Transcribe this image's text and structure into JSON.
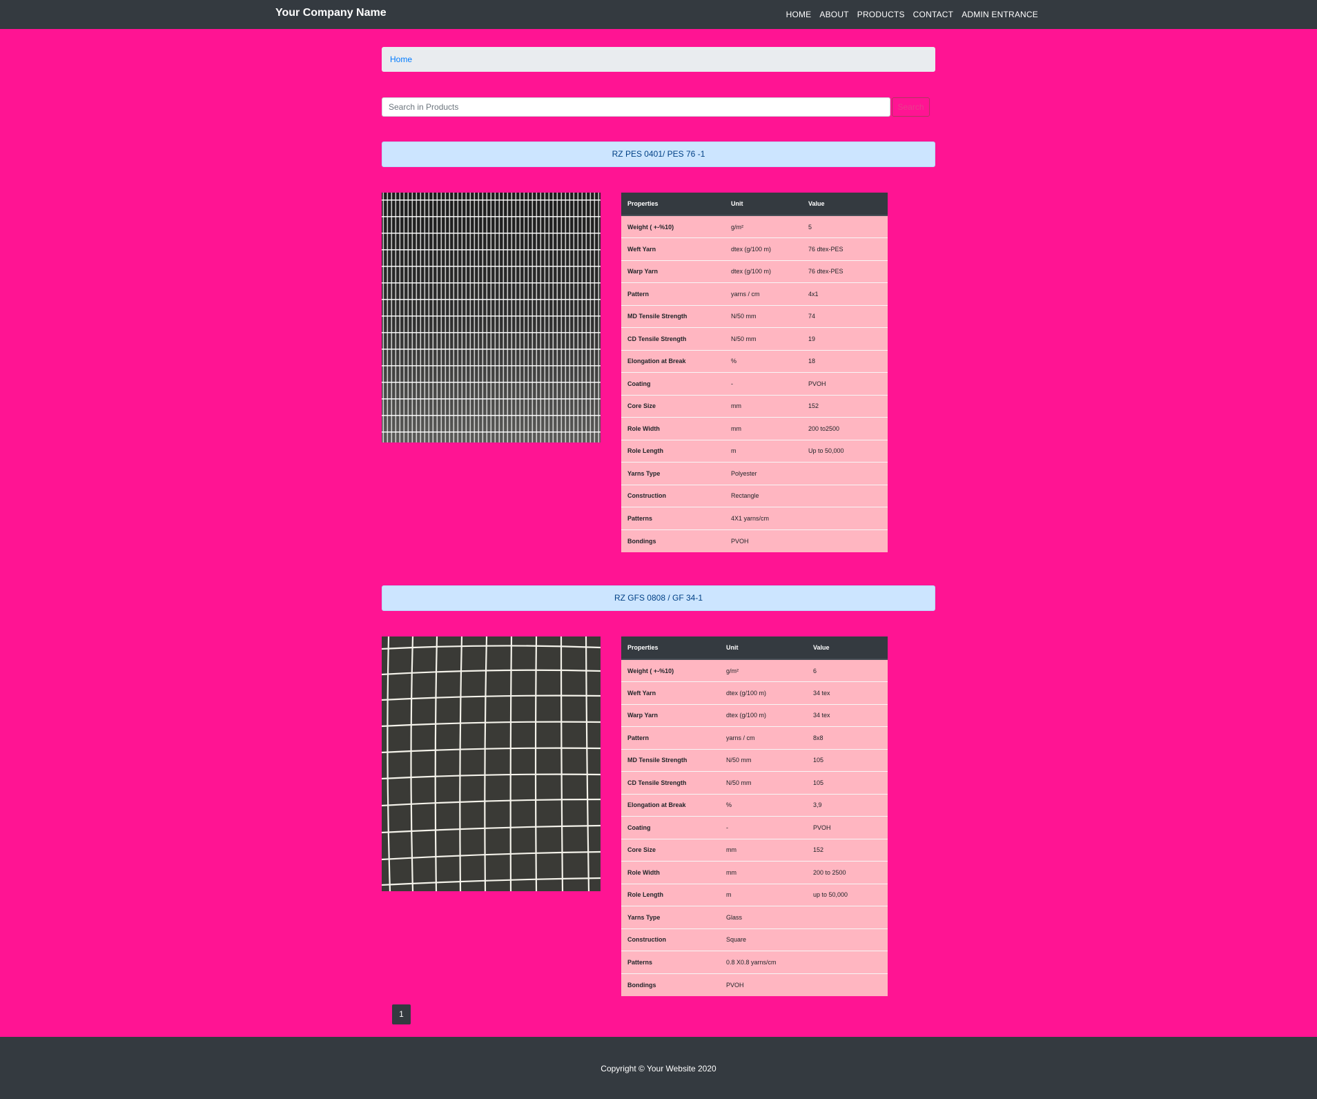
{
  "navbar": {
    "brand": "Your Company Name",
    "links": [
      "HOME",
      "ABOUT",
      "PRODUCTS",
      "CONTACT",
      "ADMIN ENTRANCE"
    ]
  },
  "breadcrumb": {
    "home": "Home"
  },
  "search": {
    "placeholder": "Search in Products",
    "button": "Search"
  },
  "table_headers": [
    "Properties",
    "Unit",
    "Value"
  ],
  "products": [
    {
      "title": "RZ PES 0401/ PES 76 -1",
      "image": "polyester-rectangle-mesh",
      "rows": [
        [
          "Weight ( +-%10)",
          "g/m²",
          "5"
        ],
        [
          "Weft Yarn",
          "dtex (g/100 m)",
          "76 dtex-PES"
        ],
        [
          "Warp Yarn",
          "dtex (g/100 m)",
          "76 dtex-PES"
        ],
        [
          "Pattern",
          "yarns / cm",
          "4x1"
        ],
        [
          "MD Tensile Strength",
          "N/50 mm",
          "74"
        ],
        [
          "CD Tensile Strength",
          "N/50 mm",
          "19"
        ],
        [
          "Elongation at Break",
          "%",
          "18"
        ],
        [
          "Coating",
          "-",
          "PVOH"
        ],
        [
          "Core Size",
          "mm",
          "152"
        ],
        [
          "Role Width",
          "mm",
          "200 to2500"
        ],
        [
          "Role Length",
          "m",
          "Up to 50,000"
        ],
        [
          "Yarns Type",
          "Polyester",
          ""
        ],
        [
          "Construction",
          "Rectangle",
          ""
        ],
        [
          "Patterns",
          "4X1 yarns/cm",
          ""
        ],
        [
          "Bondings",
          "PVOH",
          ""
        ]
      ]
    },
    {
      "title": "RZ GFS 0808 / GF 34-1",
      "image": "glass-square-mesh",
      "rows": [
        [
          "Weight ( +-%10)",
          "g/m²",
          "6"
        ],
        [
          "Weft Yarn",
          "dtex (g/100 m)",
          "34 tex"
        ],
        [
          "Warp Yarn",
          "dtex (g/100 m)",
          "34 tex"
        ],
        [
          "Pattern",
          "yarns / cm",
          "8x8"
        ],
        [
          "MD Tensile Strength",
          "N/50 mm",
          "105"
        ],
        [
          "CD Tensile Strength",
          "N/50 mm",
          "105"
        ],
        [
          "Elongation at Break",
          "%",
          "3,9"
        ],
        [
          "Coating",
          "-",
          "PVOH"
        ],
        [
          "Core Size",
          "mm",
          "152"
        ],
        [
          "Role Width",
          "mm",
          "200 to 2500"
        ],
        [
          "Role Length",
          "m",
          "up to 50,000"
        ],
        [
          "Yarns Type",
          "Glass",
          ""
        ],
        [
          "Construction",
          "Square",
          ""
        ],
        [
          "Patterns",
          "0.8 X0.8 yarns/cm",
          ""
        ],
        [
          "Bondings",
          "PVOH",
          ""
        ]
      ]
    }
  ],
  "pagination": {
    "current": "1"
  },
  "footer": {
    "copyright": "Copyright © Your Website 2020"
  },
  "colors": {
    "page_bg": "#ff1493",
    "navbar_bg": "#343a40",
    "header_bg": "#cce5ff",
    "row_bg": "#ffb6c1"
  }
}
